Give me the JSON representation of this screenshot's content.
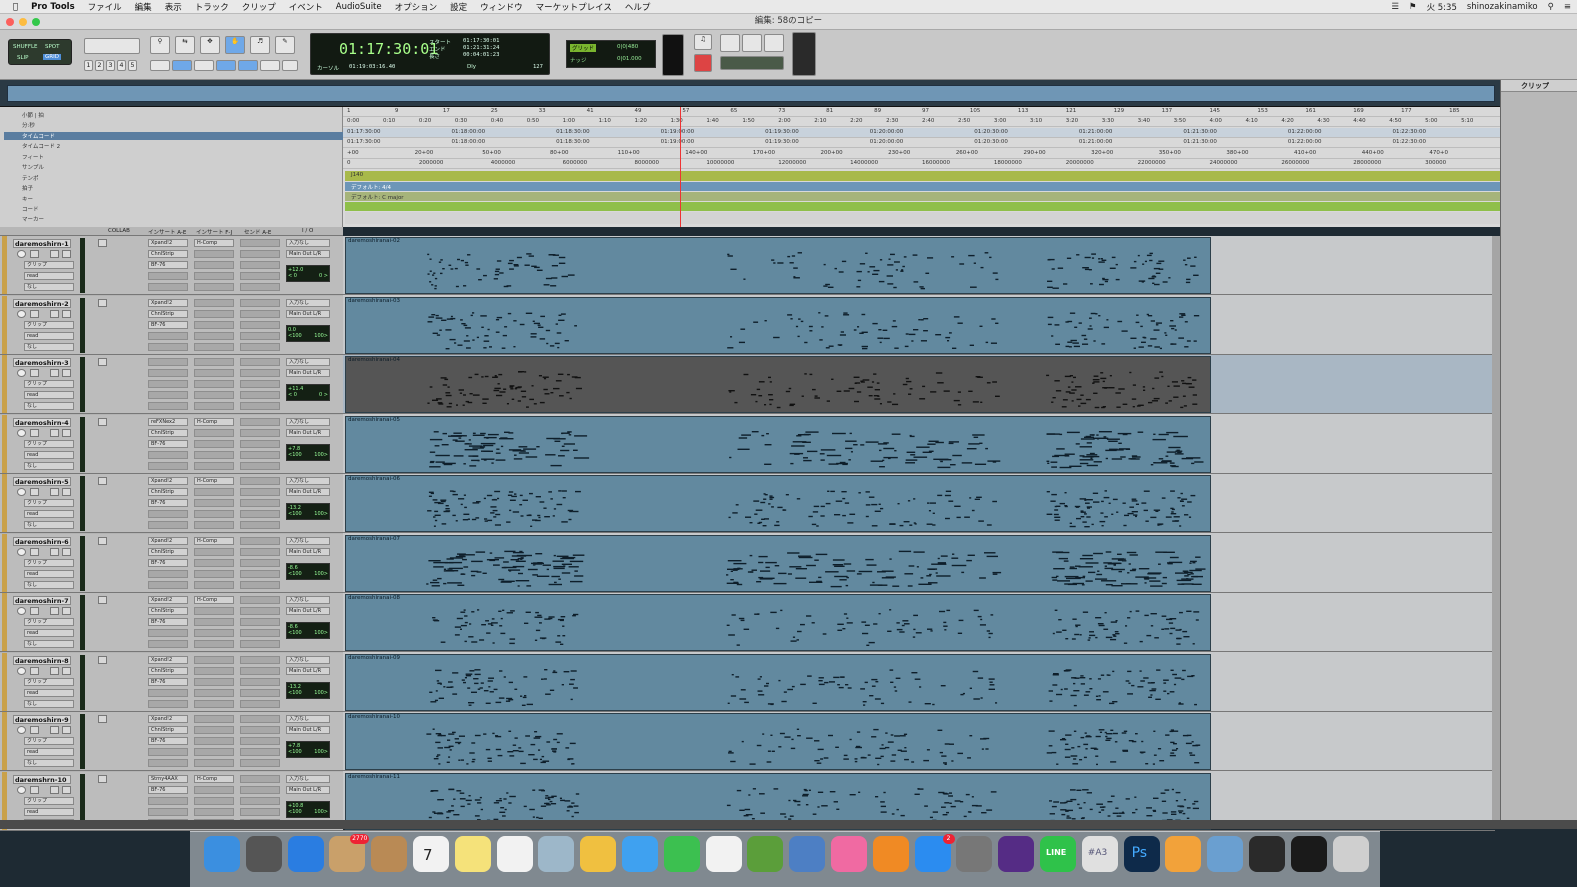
{
  "menubar": {
    "app": "Pro Tools",
    "items": [
      "ファイル",
      "編集",
      "表示",
      "トラック",
      "クリップ",
      "イベント",
      "AudioSuite",
      "オプション",
      "設定",
      "ウィンドウ",
      "マーケットプレイス",
      "ヘルプ"
    ],
    "clock": "火 5:35",
    "user": "shinozakinamiko"
  },
  "window": {
    "title": "編集: 58のコピー"
  },
  "toolbar": {
    "modes": [
      "SHUFFLE",
      "SPOT",
      "SLIP",
      "GRID"
    ],
    "zoom_presets": [
      "1",
      "2",
      "3",
      "4",
      "5"
    ],
    "main_counter": "01:17:30:01",
    "sub_counter_label": "カーソル",
    "sub_counter": "01:19:03:16.40",
    "start_label": "スタート",
    "end_label": "エンド",
    "length_label": "長さ",
    "start": "01:17:30:01",
    "end": "01:21:31:24",
    "length": "00:04:01:23",
    "tempo": "127",
    "grid_label": "グリッド",
    "grid_value": "0|0|480",
    "nudge_label": "ナッジ",
    "nudge_value": "0|01.000",
    "dly_label": "Dly"
  },
  "clips_panel": {
    "title": "クリップ"
  },
  "ruler_labels": [
    "小節 | 拍",
    "分:秒",
    "タイムコード",
    "タイムコード 2",
    "フィート",
    "サンプル",
    "テンポ",
    "拍子",
    "キー",
    "コード",
    "マーカー"
  ],
  "rulers": {
    "bars": [
      "1",
      "9",
      "17",
      "25",
      "33",
      "41",
      "49",
      "57",
      "65",
      "73",
      "81",
      "89",
      "97",
      "105",
      "113",
      "121",
      "129",
      "137",
      "145",
      "153",
      "161",
      "169",
      "177",
      "185"
    ],
    "minsec": [
      "0:00",
      "0:10",
      "0:20",
      "0:30",
      "0:40",
      "0:50",
      "1:00",
      "1:10",
      "1:20",
      "1:30",
      "1:40",
      "1:50",
      "2:00",
      "2:10",
      "2:20",
      "2:30",
      "2:40",
      "2:50",
      "3:00",
      "3:10",
      "3:20",
      "3:30",
      "3:40",
      "3:50",
      "4:00",
      "4:10",
      "4:20",
      "4:30",
      "4:40",
      "4:50",
      "5:00",
      "5:10"
    ],
    "timecode": [
      "01:17:30:00",
      "01:18:00:00",
      "01:18:30:00",
      "01:19:00:00",
      "01:19:30:00",
      "01:20:00:00",
      "01:20:30:00",
      "01:21:00:00",
      "01:21:30:00",
      "01:22:00:00",
      "01:22:30:00"
    ],
    "feet": [
      "+00",
      "20+00",
      "50+00",
      "80+00",
      "110+00",
      "140+00",
      "170+00",
      "200+00",
      "230+00",
      "260+00",
      "290+00",
      "320+00",
      "350+00",
      "380+00",
      "410+00",
      "440+00",
      "470+0"
    ],
    "samples": [
      "0",
      "2000000",
      "4000000",
      "6000000",
      "8000000",
      "10000000",
      "12000000",
      "14000000",
      "16000000",
      "18000000",
      "20000000",
      "22000000",
      "24000000",
      "26000000",
      "28000000",
      "300000"
    ],
    "tempo_text": "J140",
    "meter_text": "デフォルト: 4/4",
    "key_text": "デフォルト: C major"
  },
  "column_headers": [
    "COLLAB",
    "インサート A-E",
    "インサート F-J",
    "センド A-E",
    "I / O"
  ],
  "tracks": [
    {
      "name": "daremoshirn-1",
      "insert1": "Xpand!2",
      "insert2": "ChnlStrip",
      "insert3": "BF-76",
      "insertF": "H-Comp",
      "input": "入力なし",
      "output": "Main Out L/R",
      "vol": "+12.0",
      "pan": "< 0",
      "pan2": "0 >",
      "clip": "daremoshiranai-02",
      "mode": "クリップ",
      "auto": "read",
      "group": "なし"
    },
    {
      "name": "daremoshirn-2",
      "insert1": "Xpand!2",
      "insert2": "ChnlStrip",
      "insert3": "BF-76",
      "insertF": "",
      "input": "入力なし",
      "output": "Main Out L/R",
      "vol": "0.0",
      "pan": "<100",
      "pan2": "100>",
      "clip": "daremoshiranai-03",
      "mode": "クリップ",
      "auto": "read",
      "group": "なし"
    },
    {
      "name": "daremoshirn-3",
      "insert1": "",
      "insert2": "",
      "insert3": "",
      "insertF": "",
      "input": "入力なし",
      "output": "Main Out L/R",
      "vol": "+11.4",
      "pan": "< 0",
      "pan2": "0 >",
      "clip": "daremoshiranai-04",
      "mode": "クリップ",
      "auto": "read",
      "group": "なし"
    },
    {
      "name": "daremoshirn-4",
      "insert1": "reFXNex2",
      "insert2": "ChnlStrip",
      "insert3": "BF-76",
      "insertF": "H-Comp",
      "input": "入力なし",
      "output": "Main Out L/R",
      "vol": "+7.8",
      "pan": "<100",
      "pan2": "100>",
      "clip": "daremoshiranai-05",
      "mode": "クリップ",
      "auto": "read",
      "group": "なし"
    },
    {
      "name": "daremoshirn-5",
      "insert1": "Xpand!2",
      "insert2": "ChnlStrip",
      "insert3": "BF-76",
      "insertF": "H-Comp",
      "input": "入力なし",
      "output": "Main Out L/R",
      "vol": "-13.2",
      "pan": "<100",
      "pan2": "100>",
      "clip": "daremoshiranai-06",
      "mode": "クリップ",
      "auto": "read",
      "group": "なし"
    },
    {
      "name": "daremoshirn-6",
      "insert1": "Xpand!2",
      "insert2": "ChnlStrip",
      "insert3": "BF-76",
      "insertF": "H-Comp",
      "input": "入力なし",
      "output": "Main Out L/R",
      "vol": "-8.6",
      "pan": "<100",
      "pan2": "100>",
      "clip": "daremoshiranai-07",
      "mode": "クリップ",
      "auto": "read",
      "group": "なし"
    },
    {
      "name": "daremoshirn-7",
      "insert1": "Xpand!2",
      "insert2": "ChnlStrip",
      "insert3": "BF-76",
      "insertF": "H-Comp",
      "input": "入力なし",
      "output": "Main Out L/R",
      "vol": "-8.6",
      "pan": "<100",
      "pan2": "100>",
      "clip": "daremoshiranai-08",
      "mode": "クリップ",
      "auto": "read",
      "group": "なし"
    },
    {
      "name": "daremoshirn-8",
      "insert1": "Xpand!2",
      "insert2": "ChnlStrip",
      "insert3": "BF-76",
      "insertF": "",
      "input": "入力なし",
      "output": "Main Out L/R",
      "vol": "-13.2",
      "pan": "<100",
      "pan2": "100>",
      "clip": "daremoshiranai-09",
      "mode": "クリップ",
      "auto": "read",
      "group": "なし"
    },
    {
      "name": "daremoshirn-9",
      "insert1": "Xpand!2",
      "insert2": "ChnlStrip",
      "insert3": "BF-76",
      "insertF": "",
      "input": "入力なし",
      "output": "Main Out L/R",
      "vol": "+7.8",
      "pan": "<100",
      "pan2": "100>",
      "clip": "daremoshiranai-10",
      "mode": "クリップ",
      "auto": "read",
      "group": "なし"
    },
    {
      "name": "daremshrn-10",
      "insert1": "Strny4AAX",
      "insert2": "BF-76",
      "insert3": "",
      "insertF": "H-Comp",
      "input": "入力なし",
      "output": "Main Out L/R",
      "vol": "+10.8",
      "pan": "<100",
      "pan2": "100>",
      "clip": "daremoshiranai-11",
      "mode": "クリップ",
      "auto": "read",
      "group": "なし"
    }
  ],
  "dock": {
    "icons": [
      "finder-icon",
      "launchpad-icon",
      "safari-icon",
      "mail-icon",
      "contacts-icon",
      "calendar-icon",
      "notes-icon",
      "reminders-icon",
      "preview-icon",
      "photos-icon",
      "messages-icon",
      "facetime-icon",
      "textedit-icon",
      "numbers-icon",
      "keynote-icon",
      "itunes-icon",
      "ibooks-icon",
      "appstore-icon",
      "system-preferences-icon",
      "avid-icon",
      "line-icon",
      "hashtag-icon",
      "photoshop-icon",
      "sublime-icon",
      "image-capture-icon",
      "photo-icon",
      "ps-doc-icon",
      "trash-icon"
    ],
    "mail_badge": "2770",
    "appstore_badge": "2",
    "calendar_day": "7",
    "ps_label": "Ps",
    "line_label": "LINE",
    "hashtag_label": "#A3"
  }
}
